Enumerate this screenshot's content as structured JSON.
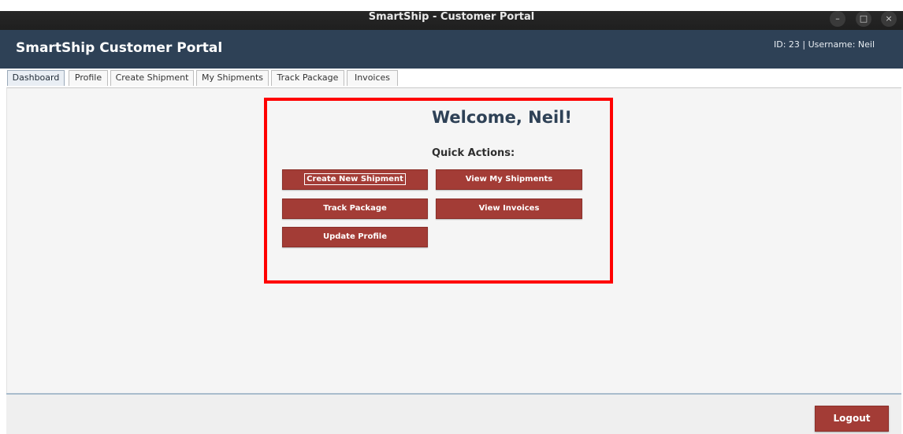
{
  "window": {
    "title": "SmartShip - Customer Portal",
    "controls": {
      "minimize": "–",
      "maximize": "□",
      "close": "×"
    }
  },
  "header": {
    "brand": "SmartShip Customer Portal",
    "user_info": "ID: 23 | Username: Neil"
  },
  "tabs": [
    {
      "label": "Dashboard",
      "active": true
    },
    {
      "label": "Profile"
    },
    {
      "label": "Create Shipment"
    },
    {
      "label": "My Shipments"
    },
    {
      "label": "Track Package"
    },
    {
      "label": "Invoices"
    }
  ],
  "dashboard": {
    "welcome": "Welcome, Neil!",
    "quick_actions_label": "Quick Actions:",
    "actions": [
      {
        "label": "Create New Shipment",
        "focused": true
      },
      {
        "label": "View My Shipments"
      },
      {
        "label": "Track Package"
      },
      {
        "label": "View Invoices"
      },
      {
        "label": "Update Profile"
      }
    ]
  },
  "footer": {
    "logout_label": "Logout"
  },
  "colors": {
    "header_bg": "#2e4156",
    "accent_button": "#a33c36",
    "highlight_border": "#ff0000",
    "welcome_text": "#2e4156"
  }
}
